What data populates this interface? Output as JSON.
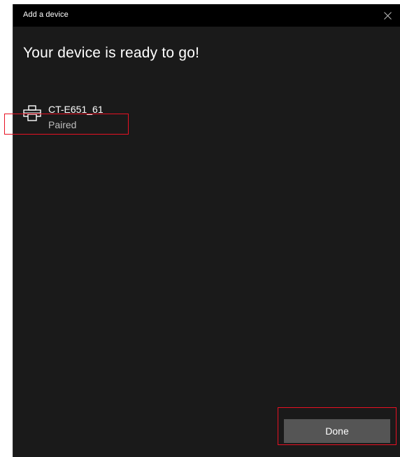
{
  "window": {
    "title": "Add a device",
    "close_icon": "close-icon"
  },
  "main": {
    "heading": "Your device is ready to go!"
  },
  "device": {
    "icon": "printer-icon",
    "name": "CT-E651_61",
    "status": "Paired"
  },
  "footer": {
    "done_label": "Done"
  },
  "colors": {
    "background": "#1a1a1a",
    "titlebar": "#000000",
    "button": "#555555",
    "status_text": "#bdbdbd",
    "highlight": "#e81123"
  }
}
